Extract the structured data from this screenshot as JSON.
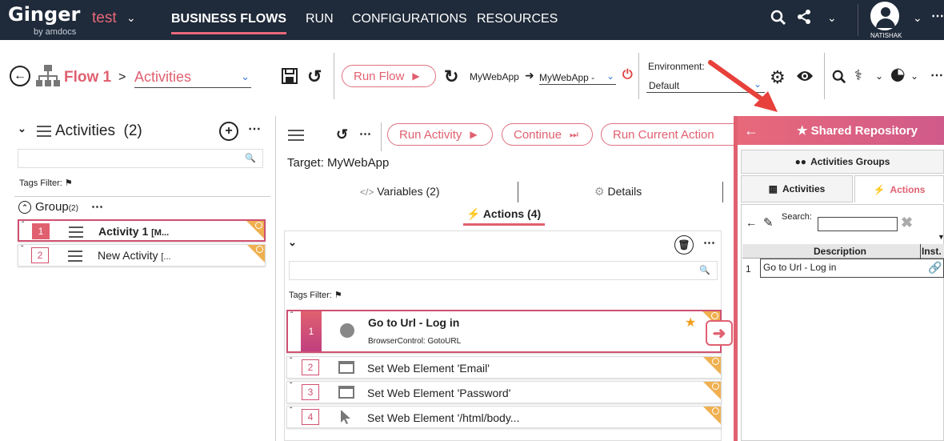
{
  "topbar": {
    "logo": "Ginger",
    "logo_sub": "by amdocs",
    "solution": "test",
    "tabs": [
      "BUSINESS FLOWS",
      "RUN",
      "CONFIGURATIONS",
      "RESOURCES"
    ],
    "user": "NATISHAK"
  },
  "flowbar": {
    "flow_name": "Flow 1",
    "breadcrumb_sep": ">",
    "section": "Activities",
    "run_flow": "Run Flow",
    "app_label": "MyWebApp",
    "app_target": "MyWebApp -",
    "env_label": "Environment:",
    "env_value": "Default"
  },
  "activities": {
    "title": "Activities",
    "count": "(2)",
    "tags_filter": "Tags Filter:",
    "group_name": "Group",
    "group_count": "(2)",
    "items": [
      {
        "num": "1",
        "name": "Activity 1",
        "suffix": "[M..."
      },
      {
        "num": "2",
        "name": "New Activity",
        "suffix": "[..."
      }
    ]
  },
  "activity_view": {
    "run_activity": "Run Activity",
    "continue": "Continue",
    "run_current_action": "Run Current Action",
    "target": "Target: MyWebApp",
    "tab_variables": "Variables (2)",
    "tab_details": "Details",
    "tab_actions": "Actions (4)",
    "tags_filter": "Tags Filter:",
    "actions": [
      {
        "num": "1",
        "name": "Go to Url - Log in",
        "sub": "BrowserControl: GotoURL",
        "icon": "globe-icon"
      },
      {
        "num": "2",
        "name": "Set Web Element 'Email'",
        "icon": "window-icon"
      },
      {
        "num": "3",
        "name": "Set Web Element 'Password'",
        "icon": "window-icon"
      },
      {
        "num": "4",
        "name": "Set Web Element '/html/body...",
        "icon": "cursor-icon"
      }
    ]
  },
  "shared_repo": {
    "title": "Shared Repository",
    "tab_groups": "Activities Groups",
    "tab_activities": "Activities",
    "tab_actions": "Actions",
    "search_label": "Search:",
    "col_description": "Description",
    "col_inst": "Inst.",
    "rows": [
      {
        "num": "1",
        "description": "Go to Url - Log in"
      }
    ]
  },
  "colors": {
    "accent": "#e06070",
    "topbar": "#1f2a3a",
    "flag": "#f0b050"
  }
}
